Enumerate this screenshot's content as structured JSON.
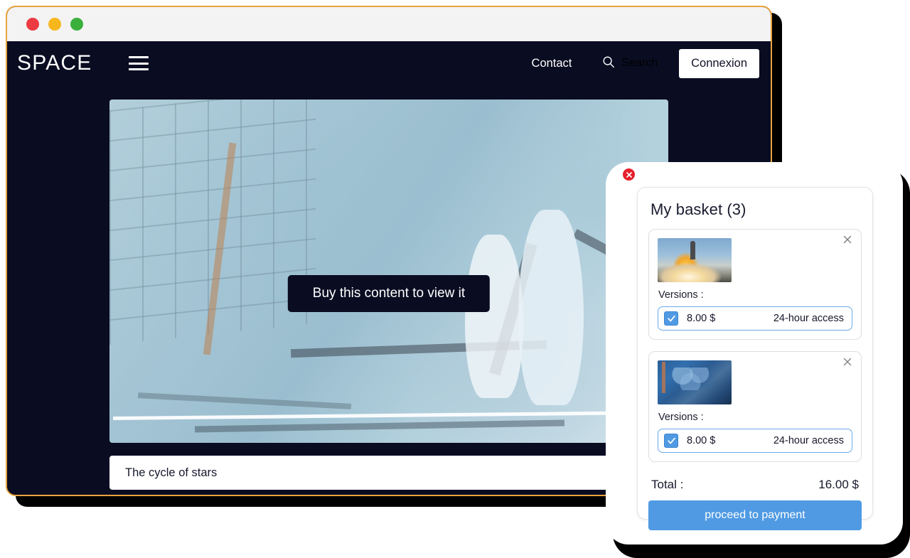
{
  "window": {
    "traffic_lights": [
      "close",
      "minimize",
      "maximize"
    ]
  },
  "nav": {
    "brand": "SPACE",
    "menu_icon": "hamburger-icon",
    "links": [
      {
        "label": "Contact"
      }
    ],
    "search": {
      "label": "Search",
      "icon": "search-icon"
    },
    "login_button": "Connexion"
  },
  "content": {
    "overlay_button": "Buy this content to view it",
    "caption": "The cycle of stars",
    "media_alt": "space-telescope-mirror-segments"
  },
  "basket": {
    "close_icon": "close-circle-icon",
    "title": "My basket (3)",
    "versions_label": "Versions :",
    "items": [
      {
        "thumbnail": "rocket-launch-thumbnail",
        "remove_icon": "close-icon",
        "versions_label": "Versions :",
        "version": {
          "checked": true,
          "price": "8.00 $",
          "access": "24-hour access"
        }
      },
      {
        "thumbnail": "mirror-segments-thumbnail",
        "remove_icon": "close-icon",
        "versions_label": "Versions :",
        "version": {
          "checked": true,
          "price": "8.00 $",
          "access": "24-hour access"
        }
      }
    ],
    "total_label": "Total :",
    "total_value": "16.00 $",
    "pay_button": "proceed to payment"
  },
  "colors": {
    "nav_background": "#0a0c22",
    "window_border": "#e8a33d",
    "accent_blue": "#4f9ae3",
    "close_red": "#e5202b",
    "titlebar": "#f3f3f3"
  }
}
